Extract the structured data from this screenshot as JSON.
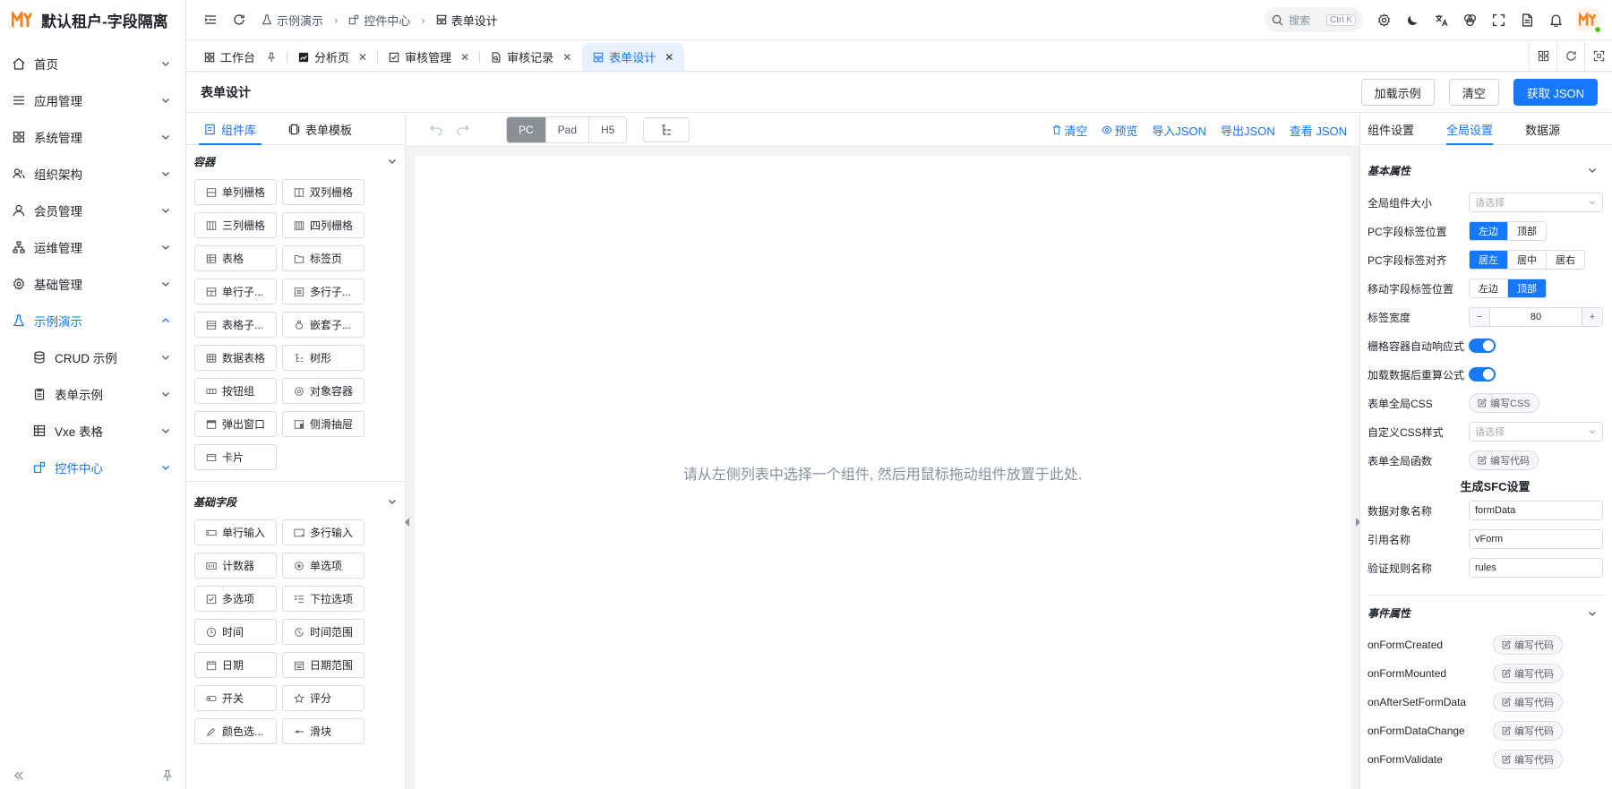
{
  "brand": {
    "title": "默认租户-字段隔离"
  },
  "sidebar": {
    "items": [
      {
        "label": "首页"
      },
      {
        "label": "应用管理"
      },
      {
        "label": "系统管理"
      },
      {
        "label": "组织架构"
      },
      {
        "label": "会员管理"
      },
      {
        "label": "运维管理"
      },
      {
        "label": "基础管理"
      },
      {
        "label": "示例演示"
      }
    ],
    "sub_items": [
      {
        "label": "CRUD 示例"
      },
      {
        "label": "表单示例"
      },
      {
        "label": "Vxe 表格"
      },
      {
        "label": "控件中心"
      }
    ]
  },
  "breadcrumb": {
    "items": [
      "示例演示",
      "控件中心",
      "表单设计"
    ]
  },
  "search": {
    "placeholder": "搜索",
    "shortcut": "Ctrl K"
  },
  "tabs": [
    {
      "label": "工作台"
    },
    {
      "label": "分析页"
    },
    {
      "label": "审核管理"
    },
    {
      "label": "审核记录"
    },
    {
      "label": "表单设计"
    }
  ],
  "page": {
    "title": "表单设计",
    "actions": {
      "load_example": "加载示例",
      "clear": "清空",
      "get_json": "获取 JSON"
    }
  },
  "left_panel": {
    "tabs": {
      "components": "组件库",
      "templates": "表单模板"
    },
    "groups": {
      "container": {
        "title": "容器",
        "items": [
          "单列栅格",
          "双列栅格",
          "三列栅格",
          "四列栅格",
          "表格",
          "标签页",
          "单行子...",
          "多行子...",
          "表格子...",
          "嵌套子...",
          "数据表格",
          "树形",
          "按钮组",
          "对象容器",
          "弹出窗口",
          "侧滑抽屉",
          "卡片"
        ]
      },
      "basic": {
        "title": "基础字段",
        "items": [
          "单行输入",
          "多行输入",
          "计数器",
          "单选项",
          "多选项",
          "下拉选项",
          "时间",
          "时间范围",
          "日期",
          "日期范围",
          "开关",
          "评分",
          "颜色选...",
          "滑块"
        ]
      }
    }
  },
  "toolbar": {
    "devices": [
      "PC",
      "Pad",
      "H5"
    ],
    "active_device": "PC",
    "links": {
      "clear": "清空",
      "preview": "预览",
      "import_json": "导入JSON",
      "export_json": "导出JSON",
      "view_json": "查看 JSON"
    }
  },
  "canvas": {
    "hint": "请从左侧列表中选择一个组件, 然后用鼠标拖动组件放置于此处."
  },
  "right_panel": {
    "tabs": {
      "component": "组件设置",
      "global": "全局设置",
      "datasource": "数据源"
    },
    "basic": {
      "title": "基本属性",
      "size_label": "全局组件大小",
      "size_placeholder": "请选择",
      "pc_label_pos": "PC字段标签位置",
      "pc_label_pos_opts": [
        "左边",
        "顶部"
      ],
      "pc_label_align": "PC字段标签对齐",
      "pc_label_align_opts": [
        "居左",
        "居中",
        "居右"
      ],
      "mobile_label_pos": "移动字段标签位置",
      "mobile_label_pos_opts": [
        "左边",
        "顶部"
      ],
      "label_width": "标签宽度",
      "label_width_value": "80",
      "grid_responsive": "栅格容器自动响应式",
      "recalc": "加载数据后重算公式",
      "global_css": "表单全局CSS",
      "edit_css": "编写CSS",
      "custom_css": "自定义CSS样式",
      "custom_css_placeholder": "请选择",
      "global_func": "表单全局函数",
      "edit_code": "编写代码"
    },
    "sfc": {
      "title": "生成SFC设置",
      "data_obj_label": "数据对象名称",
      "data_obj_value": "formData",
      "ref_label": "引用名称",
      "ref_value": "vForm",
      "rules_label": "验证规则名称",
      "rules_value": "rules"
    },
    "events": {
      "title": "事件属性",
      "items": [
        "onFormCreated",
        "onFormMounted",
        "onAfterSetFormData",
        "onFormDataChange",
        "onFormValidate"
      ],
      "button": "编写代码"
    }
  },
  "colors": {
    "accent": "#1677ff",
    "brand": "#f5821f"
  }
}
